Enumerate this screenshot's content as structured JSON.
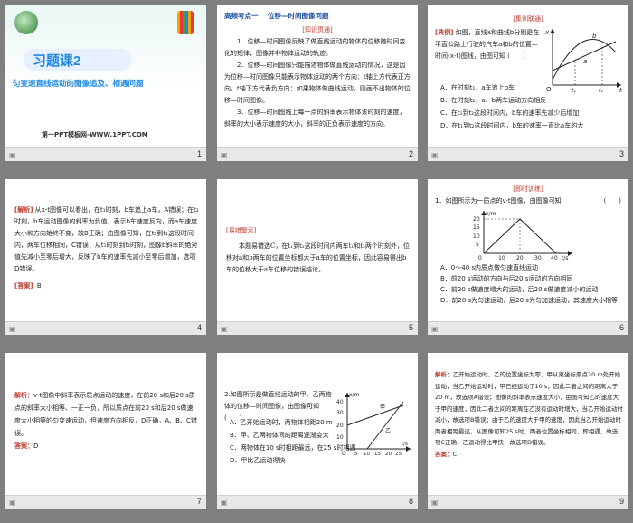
{
  "slides": [
    {
      "num": "1",
      "title": "习题课2",
      "subtitle": "匀变速直线运动的图像追及、相遇问题",
      "footer_site": "第一PPT模板网-WWW.1PPT.COM"
    },
    {
      "num": "2",
      "heading_a": "高频考点一",
      "heading_b": "位移—时间图像问题",
      "tag": "[知识贯通]",
      "p1": "1．位移—时间图像反映了做直线运动的物体的位移随时间变化的规律，图像并非物体运动的轨迹。",
      "p2": "2．位移—时间图像只能描述物体做直线运动的情况，这是因为位移—时间图像只能表示物体运动的两个方向：t轴上方代表正方向，t轴下方代表负方向；如果物体做曲线运动，则画不出物体的位移—时间图像。",
      "p3": "3．位移—时间图线上每一点的斜率表示物体该时刻的速度，斜率的大小表示速度的大小，斜率的正负表示速度的方向。"
    },
    {
      "num": "3",
      "tag": "[集训联通]",
      "example_label": "[典例]",
      "q": "如图，直线a和曲线b分别是在平直公路上行驶的汽车a和b的位置—时间(x-t)图线，由图可知",
      "paren": "(　　)",
      "options": [
        "A．在时刻t₁，a车追上b车",
        "B．在时刻t₂，a、b两车运动方向相反",
        "C．在t₁到t₂这段时间内，b车的速率先减少后增加",
        "D．在t₁到t₂这段时间内，b车的速率一直比a车的大"
      ],
      "graph": {
        "y": "x",
        "x": "t",
        "o": "O",
        "a": "a",
        "b": "b",
        "t1": "t₁",
        "t2": "t₂"
      }
    },
    {
      "num": "4",
      "label": "[解析]",
      "text": "从x-t图像可以看出，在t₁时刻，b车追上a车，A错误；在t₂时刻，b车运动图像的斜率为负值，表示b车速度反向，而a车速度大小和方向始终不变，故B正确；由图像可知，在t₁到t₂这段时间内，两车位移相同，C错误；从t₁时刻到t₂时刻，图像b斜率的绝对值先减小至零后增大，反映了b车的速率先减小至零后增加，选项D错误。",
      "ans_label": "[答案]",
      "ans": "B"
    },
    {
      "num": "5",
      "tag": "[易错警示]",
      "text": "本题易错选C，在t₁到t₂这段时间内两车t₁和t₂两个时刻外，位移对a和b两车的位置坐标都大于a车的位置坐标，因此容易得出b车的位移大于a车位移的错误结论。"
    },
    {
      "num": "6",
      "tag": "[即时训练]",
      "q": "1．如图所示为一质点的v-t图像，由图像可知",
      "paren": "(　　)",
      "options": [
        "A．0～40 s内质点做匀速直线运动",
        "B．前20 s运动的方向与后20 s运动的方向相同",
        "C．前20 s做速度增大的运动，后20 s做速度减小的运动",
        "D．前20 s为匀速运动，后20 s为匀加速运动，其速度大小相等"
      ],
      "graph": {
        "unit": "v/m",
        "yticks": [
          "20",
          "15",
          "10",
          "5"
        ],
        "xticks": [
          "10",
          "20",
          "30",
          "40"
        ],
        "xunit": "t/s",
        "o": "0"
      }
    },
    {
      "num": "7",
      "label": "解析：",
      "text": "v-t图像中斜率表示质点运动的速度，在前20 s和后20 s质点的斜率大小相等、一正一负，所以质点在前20 s和后20 s做速度大小相等的匀变速运动，但速度方向相反，D正确，A、B、C错误。",
      "ans_label": "答案：",
      "ans": "D"
    },
    {
      "num": "8",
      "q": "2.如图所示是做直线运动的甲、乙两物体的位移—时间图像，由图像可知",
      "paren": "(　　)",
      "options": [
        "A．乙开始运动时，两物体相距20 m",
        "B．甲、乙两物体间的距离逐渐变大",
        "C．两物体在10 s时相距最远，在25 s时相遇",
        "D．甲比乙运动得快"
      ],
      "graph": {
        "unit": "x/m",
        "yticks": [
          "40",
          "30",
          "20",
          "10"
        ],
        "xticks": [
          "5",
          "10",
          "15",
          "20",
          "25"
        ],
        "xunit": "t/s",
        "jia": "甲",
        "yi": "乙",
        "o": "O"
      }
    },
    {
      "num": "9",
      "label": "解析：",
      "text": "乙开始运动时，乙的位置坐标为零，甲从离坐标原点20 m处开始运动，当乙开始运动时，甲已经运动了10 s，因此二者之间的距离大于20 m，故选项A错误；图像的斜率表示速度大小，由图可知乙的速度大于甲的速度，因此二者之间的距离在乙没有运动时增大，当乙开始运动时减小，故选项B错误；由于乙的速度大于甲的速度，因此当乙开始运动时两者相距最远，从图像可知25 s时，两者位置坐标相同，即相遇，故选项C正确；乙运动得比甲快，故选项D错误。",
      "ans_label": "答案：",
      "ans": "C"
    }
  ],
  "footer_icon": "slide-icon",
  "colors": {
    "bg": "#7f7f7f",
    "accent_red": "#c0392b",
    "accent_blue": "#1f4fa3",
    "teal": "#2a9d8f"
  }
}
